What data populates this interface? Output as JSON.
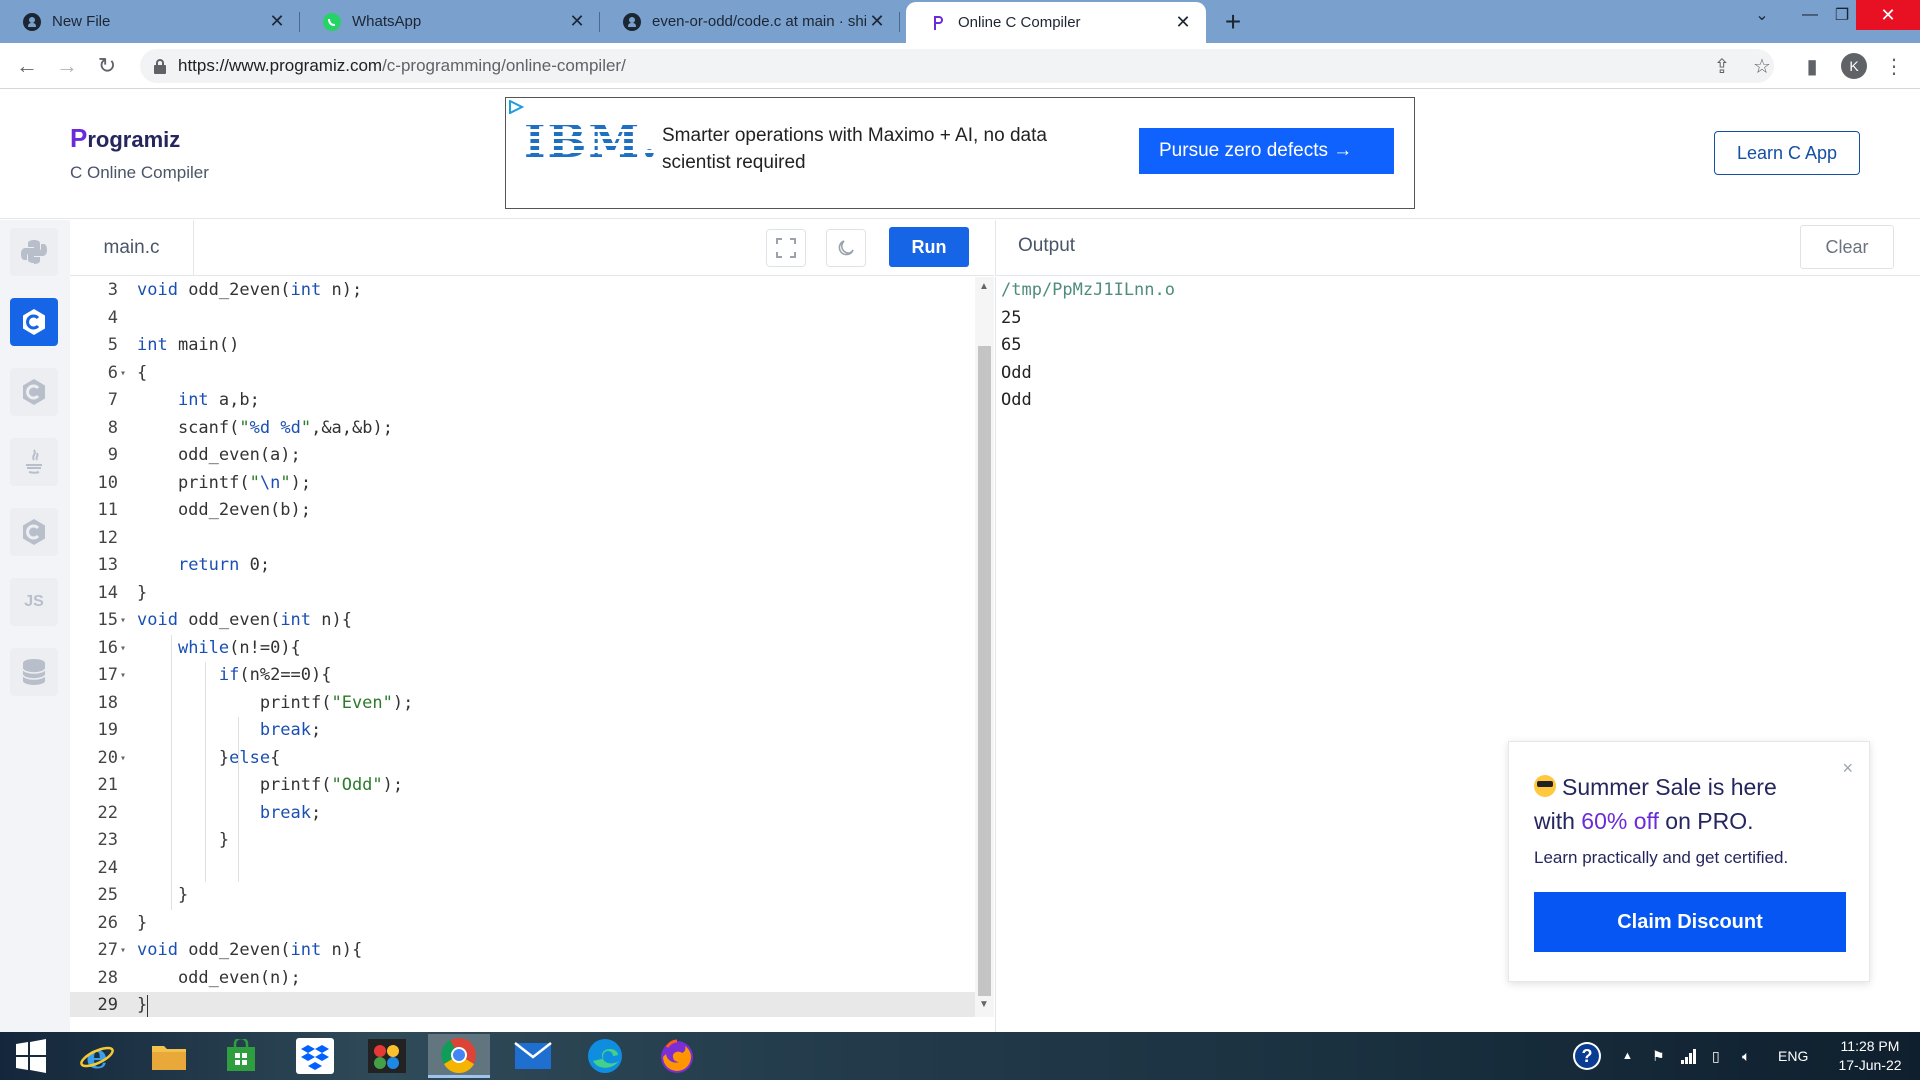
{
  "browser": {
    "tabs": [
      {
        "title": "New File",
        "icon": "github-icon"
      },
      {
        "title": "WhatsApp",
        "icon": "whatsapp-icon"
      },
      {
        "title": "even-or-odd/code.c at main · shi",
        "icon": "github-icon"
      },
      {
        "title": "Online C Compiler",
        "icon": "programiz-icon",
        "active": true
      }
    ],
    "new_tab": "+",
    "url_host": "https://www.programiz.com",
    "url_path": "/c-programming/online-compiler/",
    "profile_initial": "K"
  },
  "site": {
    "logo_text": "rogramiz",
    "logo_mark": "P",
    "subtitle": "C Online Compiler",
    "learn_button": "Learn C App"
  },
  "ad": {
    "brand": "IBM.",
    "text": "Smarter operations with Maximo + AI, no data scientist required",
    "button": "Pursue zero defects →"
  },
  "sidebar": {
    "languages": [
      {
        "name": "python-icon",
        "label": ""
      },
      {
        "name": "c-icon",
        "label": "",
        "active": true
      },
      {
        "name": "cpp-icon",
        "label": ""
      },
      {
        "name": "java-icon",
        "label": ""
      },
      {
        "name": "csharp-icon",
        "label": ""
      },
      {
        "name": "js-icon",
        "label": "JS"
      },
      {
        "name": "database-icon",
        "label": ""
      }
    ]
  },
  "editor": {
    "file_name": "main.c",
    "run_label": "Run",
    "lines": [
      {
        "n": "3",
        "code": "void odd_2even(int n);"
      },
      {
        "n": "4",
        "code": ""
      },
      {
        "n": "5",
        "code": "int main()"
      },
      {
        "n": "6",
        "code": "{",
        "fold": true
      },
      {
        "n": "7",
        "code": "    int a,b;"
      },
      {
        "n": "8",
        "code": "    scanf(\"%d %d\",&a,&b);"
      },
      {
        "n": "9",
        "code": "    odd_even(a);"
      },
      {
        "n": "10",
        "code": "    printf(\"\\n\");"
      },
      {
        "n": "11",
        "code": "    odd_2even(b);"
      },
      {
        "n": "12",
        "code": ""
      },
      {
        "n": "13",
        "code": "    return 0;"
      },
      {
        "n": "14",
        "code": "}"
      },
      {
        "n": "15",
        "code": "void odd_even(int n){",
        "fold": true
      },
      {
        "n": "16",
        "code": "    while(n!=0){",
        "fold": true
      },
      {
        "n": "17",
        "code": "        if(n%2==0){",
        "fold": true
      },
      {
        "n": "18",
        "code": "            printf(\"Even\");"
      },
      {
        "n": "19",
        "code": "            break;"
      },
      {
        "n": "20",
        "code": "        }else{",
        "fold": true
      },
      {
        "n": "21",
        "code": "            printf(\"Odd\");"
      },
      {
        "n": "22",
        "code": "            break;"
      },
      {
        "n": "23",
        "code": "        }"
      },
      {
        "n": "24",
        "code": ""
      },
      {
        "n": "25",
        "code": "    }"
      },
      {
        "n": "26",
        "code": "}"
      },
      {
        "n": "27",
        "code": "void odd_2even(int n){",
        "fold": true
      },
      {
        "n": "28",
        "code": "    odd_even(n);"
      },
      {
        "n": "29",
        "code": "}",
        "current": true
      }
    ]
  },
  "output": {
    "title": "Output",
    "clear_label": "Clear",
    "lines": [
      "/tmp/PpMzJ1ILnn.o",
      "25",
      "65",
      "Odd",
      "Odd"
    ]
  },
  "promo": {
    "line1": "Summer Sale is here",
    "line2_pre": "with ",
    "line2_accent": "60% off",
    "line2_post": " on PRO.",
    "sub": "Learn practically and get certified.",
    "button": "Claim Discount",
    "close": "×"
  },
  "taskbar": {
    "apps": [
      "windows-start-icon",
      "ie-icon",
      "file-explorer-icon",
      "store-icon",
      "dropbox-icon",
      "paint-icon",
      "chrome-icon",
      "mail-icon",
      "edge-icon",
      "firefox-icon"
    ],
    "lang": "ENG",
    "time": "11:28 PM",
    "date": "17-Jun-22"
  },
  "colors": {
    "accent": "#1565e6",
    "promo_accent": "#6c2bd9",
    "ad_button": "#0f62fe",
    "tabbar": "#7aa0ce"
  }
}
